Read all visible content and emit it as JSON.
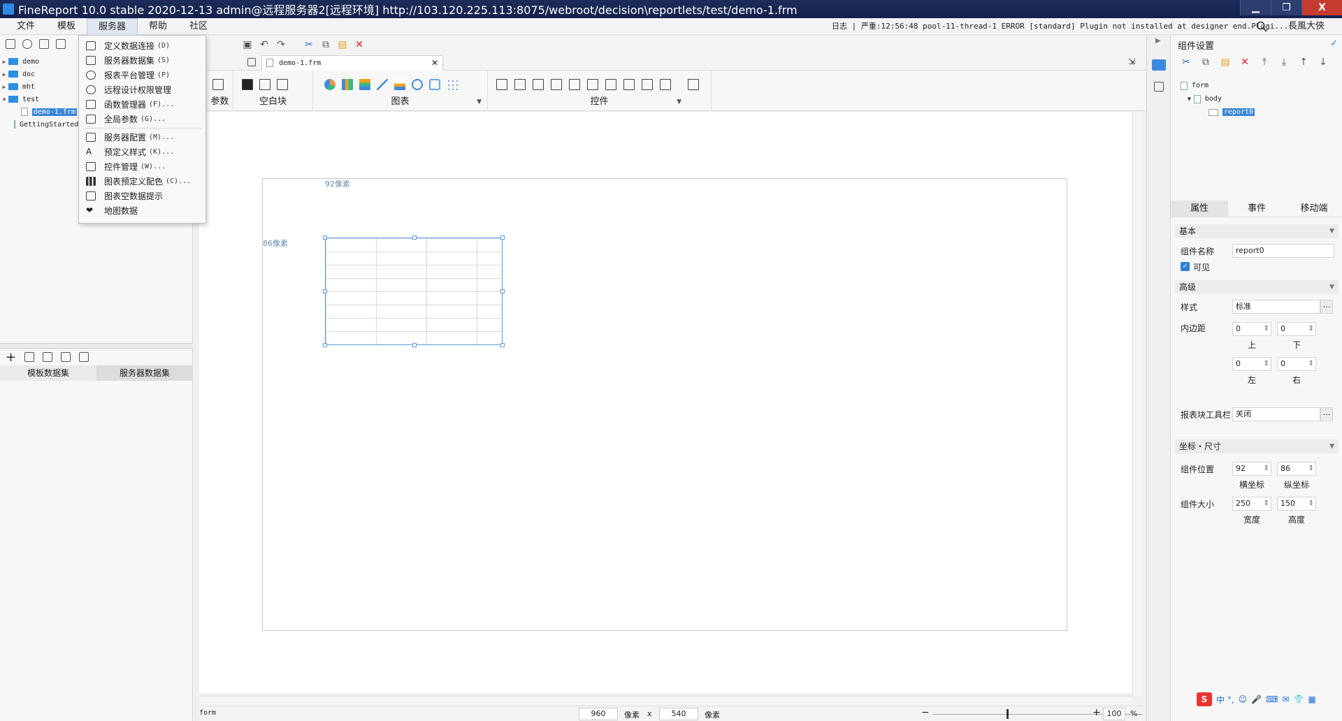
{
  "window": {
    "title": "FineReport 10.0 stable 2020-12-13 admin@远程服务器2[远程环境]    http://103.120.225.113:8075/webroot/decision\\reportlets/test/demo-1.frm",
    "close_label": "X"
  },
  "menubar": {
    "items": [
      "文件",
      "模板",
      "服务器",
      "帮助",
      "社区"
    ],
    "log_text": "日志 | 严重:12:56:48 pool-11-thread-1 ERROR [standard] Plugin not installed at designer end.Plugi...",
    "user": "長風大俠"
  },
  "left_tree": {
    "nodes": [
      "demo",
      "doc",
      "mht",
      "test",
      "demo-1.frm",
      "GettingStarted"
    ]
  },
  "left_tabs": [
    "模板数据集",
    "服务器数据集"
  ],
  "server_menu": {
    "items": [
      {
        "label": "定义数据连接",
        "key": "(D)"
      },
      {
        "label": "服务器数据集",
        "key": "(S)"
      },
      {
        "label": "报表平台管理",
        "key": "(P)"
      },
      {
        "label": "远程设计权限管理",
        "key": ""
      },
      {
        "label": "函数管理器",
        "key": "(F)..."
      },
      {
        "label": "全局参数",
        "key": "(G)..."
      },
      {
        "label": "服务器配置",
        "key": "(M)..."
      },
      {
        "label": "预定义样式",
        "key": "(K)..."
      },
      {
        "label": "控件管理",
        "key": "(W)..."
      },
      {
        "label": "图表预定义配色",
        "key": "(C)..."
      },
      {
        "label": "图表空数据提示",
        "key": ""
      },
      {
        "label": "地图数据",
        "key": ""
      }
    ]
  },
  "editor": {
    "tab_name": "demo-1.frm",
    "groups": {
      "param": "参数",
      "blank": "空白块",
      "chart": "图表",
      "widget": "控件"
    },
    "ruler_x": "92像素",
    "ruler_y": "86像素"
  },
  "statusbar": {
    "left": "form",
    "width": "960",
    "unit1": "像素",
    "x": "x",
    "height": "540",
    "unit2": "像素",
    "zoom": "100",
    "percent": "%"
  },
  "right_panel": {
    "title": "组件设置",
    "tree": [
      "form",
      "body",
      "report0"
    ],
    "tabs": [
      "属性",
      "事件",
      "移动端"
    ],
    "sections": {
      "basic": "基本",
      "advanced": "高级",
      "pos": "坐标・尺寸"
    },
    "name_label": "组件名称",
    "name_value": "report0",
    "visible_label": "可见",
    "style_label": "样式",
    "style_value": "标准",
    "padding_label": "内边距",
    "padding": {
      "top": "0",
      "bottom": "0",
      "left": "0",
      "right": "0"
    },
    "padding_sub": {
      "top": "上",
      "bottom": "下",
      "left": "左",
      "right": "右"
    },
    "toolbar_label": "报表块工具栏",
    "toolbar_value": "关闭",
    "position_label": "组件位置",
    "position": {
      "x": "92",
      "y": "86"
    },
    "position_sub": {
      "x": "横坐标",
      "y": "纵坐标"
    },
    "size_label": "组件大小",
    "size": {
      "w": "250",
      "h": "150"
    },
    "size_sub": {
      "w": "宽度",
      "h": "高度"
    }
  },
  "ime": {
    "chars": "中 °,"
  }
}
